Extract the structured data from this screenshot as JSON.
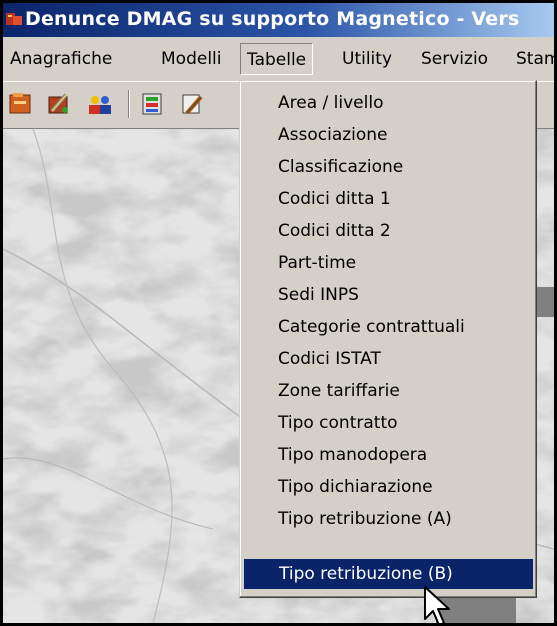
{
  "window": {
    "title": "Denunce DMAG su supporto Magnetico - Vers"
  },
  "menubar": {
    "items": [
      "Anagrafiche",
      "Modelli",
      "Tabelle",
      "Utility",
      "Servizio",
      "Stam"
    ],
    "active": "Tabelle"
  },
  "toolbar": {
    "icons": [
      "folder-icon",
      "tools-icon",
      "users-icon",
      "database-icon",
      "edit-icon"
    ]
  },
  "tabelle_menu": {
    "items": [
      "Area / livello",
      "Associazione",
      "Classificazione",
      "Codici ditta 1",
      "Codici ditta 2",
      "Part-time",
      "Sedi INPS",
      "Categorie contrattuali",
      "Codici ISTAT",
      "Zone tariffarie",
      "Tipo contratto",
      "Tipo manodopera",
      "Tipo dichiarazione",
      "Tipo retribuzione (A)",
      "Tipo retribuzione (B)"
    ],
    "selected": "Tipo retribuzione (B)"
  },
  "colors": {
    "title_gradient_start": "#0a246a",
    "title_gradient_end": "#a6caf0",
    "menu_bg": "#d4d0c8",
    "highlight": "#0a246a"
  }
}
